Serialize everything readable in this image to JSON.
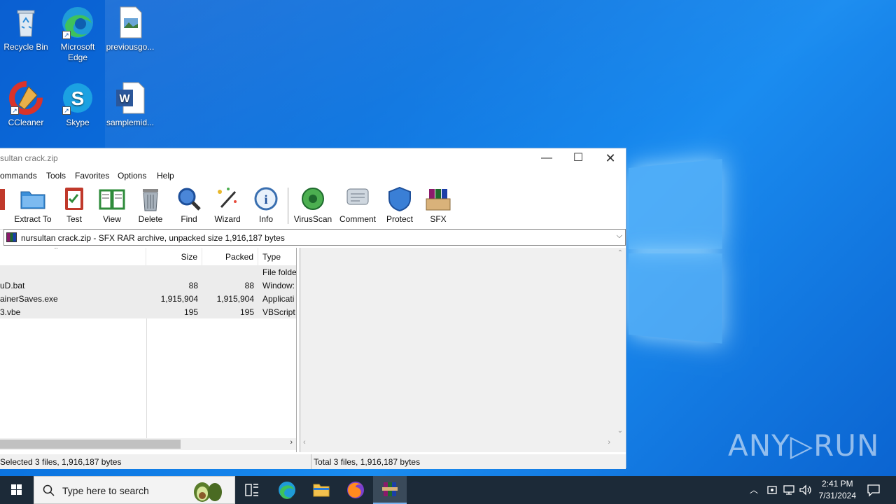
{
  "desktop": {
    "icons": [
      {
        "label": "Recycle Bin"
      },
      {
        "label": "Microsoft Edge"
      },
      {
        "label": "previousgo..."
      },
      {
        "label": "CCleaner"
      },
      {
        "label": "Skype"
      },
      {
        "label": "samplemid..."
      }
    ],
    "watermark": "ANY▷RUN"
  },
  "window": {
    "title": "sultan crack.zip",
    "menu": [
      "ommands",
      "Tools",
      "Favorites",
      "Options",
      "Help"
    ],
    "toolbar": [
      "Extract To",
      "Test",
      "View",
      "Delete",
      "Find",
      "Wizard",
      "Info",
      "VirusScan",
      "Comment",
      "Protect",
      "SFX"
    ],
    "address": "nursultan crack.zip - SFX RAR archive, unpacked size 1,916,187 bytes",
    "columns": {
      "size": "Size",
      "packed": "Packed",
      "type": "Type"
    },
    "files": [
      {
        "name": "",
        "size": "",
        "packed": "",
        "type": "File folde"
      },
      {
        "name": "uD.bat",
        "size": "88",
        "packed": "88",
        "type": "Window:"
      },
      {
        "name": "ainerSaves.exe",
        "size": "1,915,904",
        "packed": "1,915,904",
        "type": "Applicati"
      },
      {
        "name": "3.vbe",
        "size": "195",
        "packed": "195",
        "type": "VBScript"
      }
    ],
    "status_left": "Selected 3 files, 1,916,187 bytes",
    "status_right": "Total 3 files, 1,916,187 bytes"
  },
  "taskbar": {
    "search_placeholder": "Type here to search",
    "time": "2:41 PM",
    "date": "7/31/2024"
  }
}
